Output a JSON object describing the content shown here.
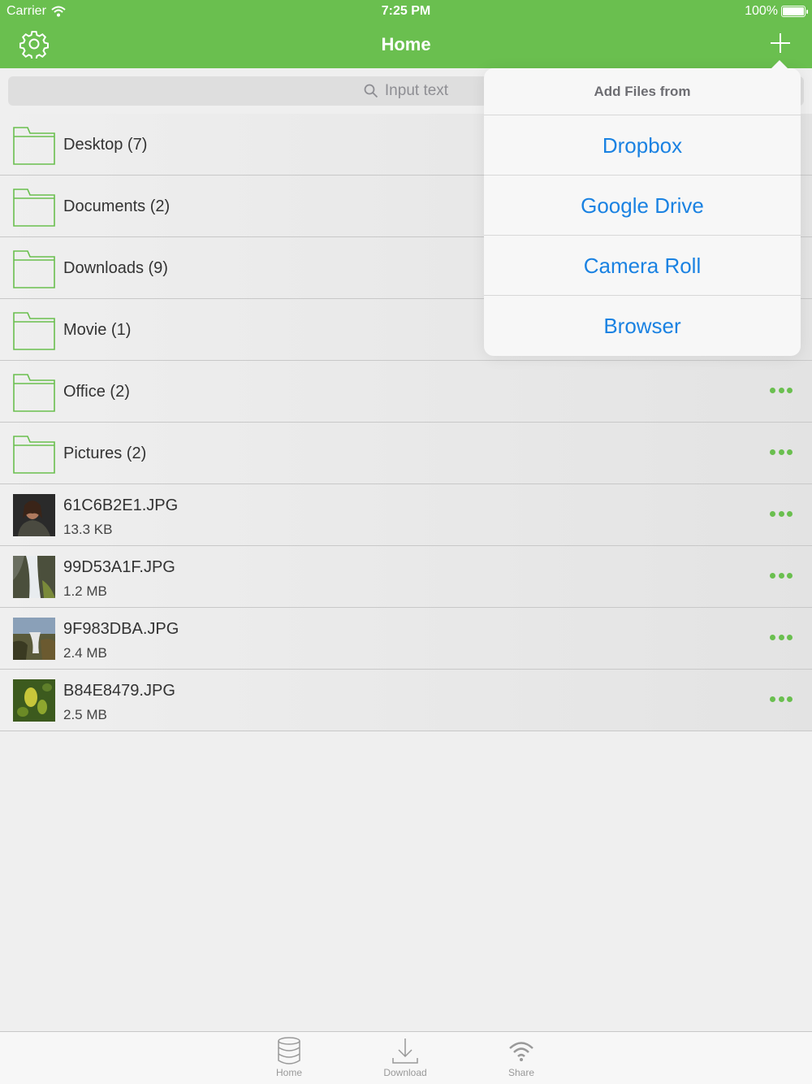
{
  "status_bar": {
    "carrier": "Carrier",
    "time": "7:25 PM",
    "battery": "100%"
  },
  "header": {
    "title": "Home",
    "left_icon": "gear-icon",
    "right_icon": "plus-icon"
  },
  "search": {
    "placeholder": "Input text"
  },
  "items": [
    {
      "type": "folder",
      "name": "Desktop (7)"
    },
    {
      "type": "folder",
      "name": "Documents (2)"
    },
    {
      "type": "folder",
      "name": "Downloads (9)"
    },
    {
      "type": "folder",
      "name": "Movie (1)"
    },
    {
      "type": "folder",
      "name": "Office (2)"
    },
    {
      "type": "folder",
      "name": "Pictures (2)"
    },
    {
      "type": "file",
      "name": "61C6B2E1.JPG",
      "size": "13.3 KB"
    },
    {
      "type": "file",
      "name": "99D53A1F.JPG",
      "size": "1.2 MB"
    },
    {
      "type": "file",
      "name": "9F983DBA.JPG",
      "size": "2.4 MB"
    },
    {
      "type": "file",
      "name": "B84E8479.JPG",
      "size": "2.5 MB"
    }
  ],
  "popover": {
    "title": "Add Files from",
    "options": [
      "Dropbox",
      "Google Drive",
      "Camera Roll",
      "Browser"
    ]
  },
  "tabbar": {
    "tabs": [
      "Home",
      "Download",
      "Share"
    ]
  },
  "colors": {
    "accent": "#6abf4f",
    "link": "#1a82e2"
  }
}
